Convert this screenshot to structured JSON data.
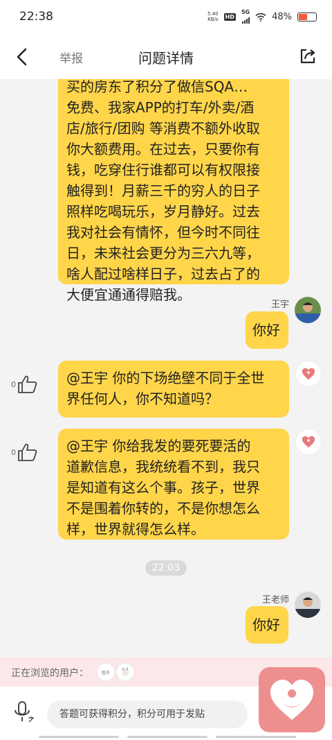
{
  "status_bar": {
    "time": "22:38",
    "net_speed_value": "5.40",
    "net_speed_unit": "KB/s",
    "hd": "HD",
    "network": "5G",
    "battery": "48%"
  },
  "nav": {
    "report": "举报",
    "title": "问题详情"
  },
  "messages": [
    {
      "lines": [
        "买的房东了积分了做信SQA…",
        "免费、我家APP的打车/外卖/酒",
        "店/旅行/团购 等消费不额外收取",
        "你大额费用。在过去，只要你有",
        "钱，吃穿住行谁都可以有权限接",
        "触得到！月薪三千的穷人的日子",
        "照样吃喝玩乐，岁月静好。过去",
        "我对社会有情怀，但今时不同往",
        "日，未来社会更分为三六九等，",
        "啥人配过啥样日子，过去占了的",
        "大便宜通通得赔我。"
      ]
    },
    {
      "sender": "王宇",
      "text": "你好"
    },
    {
      "lines": [
        "@王宇 你的下场绝壁不同于全世",
        "界任何人，你不知道吗？"
      ],
      "like_count": "0"
    },
    {
      "lines": [
        "@王宇 你给我发的要死要活的",
        "道歉信息，我统统看不到，我只",
        "是知道有这么个事。孩子，世界",
        "不是围着你转的，不是你想怎么",
        "样，世界就得怎么样。"
      ],
      "like_count": "0"
    },
    {
      "sender": "王老师",
      "text": "你好"
    }
  ],
  "timestamp": "22:03",
  "viewers": {
    "label": "正在浏览的用户：",
    "badge1": "匿名"
  },
  "input": {
    "placeholder": "答题可获得积分，积分可用于发贴"
  },
  "colors": {
    "bubble": "#ffd54a",
    "fab": "#ee8f8f",
    "viewers_bg": "#fce8e8"
  }
}
